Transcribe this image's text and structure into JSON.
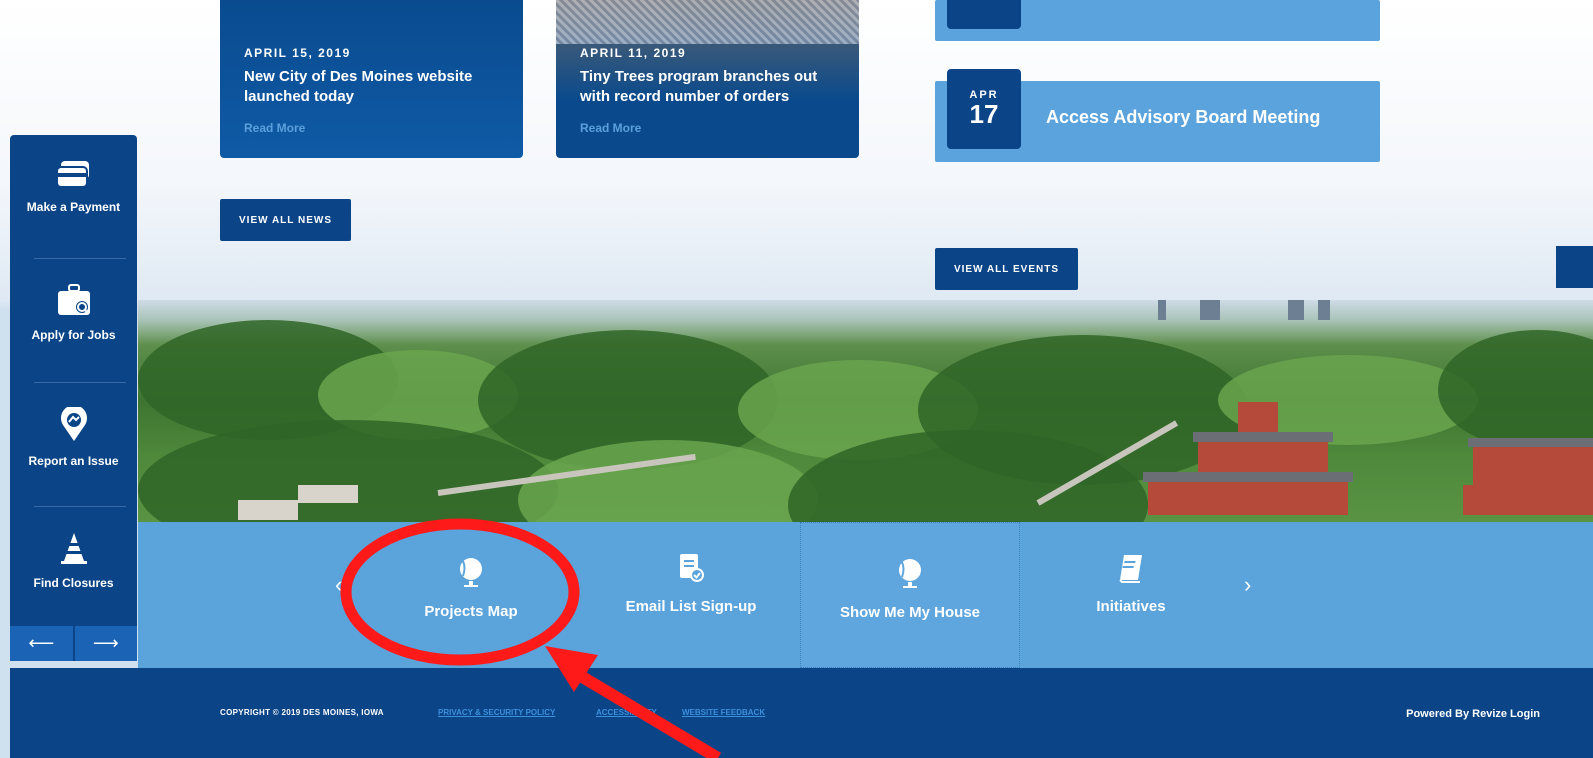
{
  "news": [
    {
      "date": "APRIL 15, 2019",
      "title": "New City of Des Moines website launched today",
      "more": "Read More"
    },
    {
      "date": "APRIL 11, 2019",
      "title": "Tiny Trees program branches out with record number of orders",
      "more": "Read More"
    }
  ],
  "view_all_news": "VIEW ALL NEWS",
  "event": {
    "month": "APR",
    "day": "17",
    "title": "Access Advisory Board Meeting"
  },
  "view_all_events": "VIEW ALL EVENTS",
  "quick_links": [
    {
      "label": "Make a Payment",
      "icon": "card-icon"
    },
    {
      "label": "Apply for Jobs",
      "icon": "briefcase-search-icon"
    },
    {
      "label": "Report an Issue",
      "icon": "location-pin-icon"
    },
    {
      "label": "Find Closures",
      "icon": "traffic-cone-icon"
    }
  ],
  "quick_nav": {
    "prev": "⟵",
    "next": "⟶"
  },
  "strip_items": [
    {
      "label": "Projects Map",
      "icon": "globe-icon"
    },
    {
      "label": "Email List Sign-up",
      "icon": "form-check-icon"
    },
    {
      "label": "Show Me My House",
      "icon": "globe-icon"
    },
    {
      "label": "Initiatives",
      "icon": "book-icon"
    }
  ],
  "strip_nav": {
    "prev": "‹",
    "next": "›"
  },
  "footer": {
    "copyright": "COPYRIGHT © 2019 DES MOINES, IOWA",
    "links": [
      "PRIVACY & SECURITY POLICY",
      "ACCESSIBILITY",
      "WEBSITE FEEDBACK"
    ],
    "powered": "Powered By Revize Login"
  },
  "colors": {
    "primary": "#0b4588",
    "accent": "#5aa3db",
    "annotation": "#ff1a1a"
  }
}
